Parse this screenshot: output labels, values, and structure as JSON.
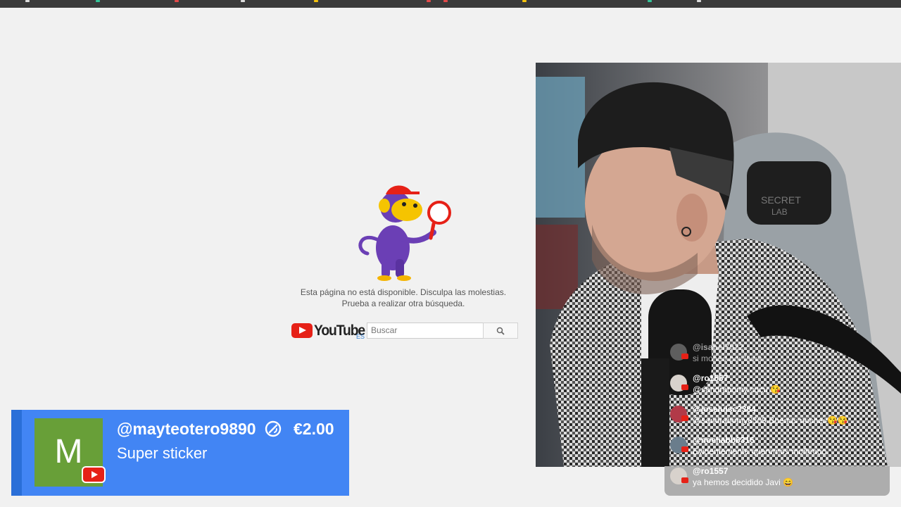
{
  "error_page": {
    "message_line1": "Esta página no está disponible. Disculpa las molestias.",
    "message_line2": "Prueba a realizar otra búsqueda.",
    "logo_text": "YouTube",
    "region_code": "ES",
    "search_placeholder": "Buscar"
  },
  "chat": {
    "messages": [
      {
        "user": "@isabel7022",
        "text": "si moñeo por favor"
      },
      {
        "user": "@ro1557",
        "text": "@sandrabomy cucu 😘"
      },
      {
        "user": "@joseluisc2384",
        "text": "@sandrabomy8309 Buenas noches😘😘"
      },
      {
        "user": "@noeliabb6316",
        "text": "Evidentemente queremos moñeooo"
      },
      {
        "user": "@ro1557",
        "text": "ya hemos decidido Javi 😄"
      }
    ]
  },
  "super_sticker": {
    "avatar_letter": "M",
    "username": "@mayteotero9890",
    "amount": "€2.00",
    "subtitle": "Super sticker"
  },
  "colors": {
    "alert_bg": "#4285f4",
    "avatar_bg": "#689f38",
    "youtube_red": "#e62117"
  }
}
